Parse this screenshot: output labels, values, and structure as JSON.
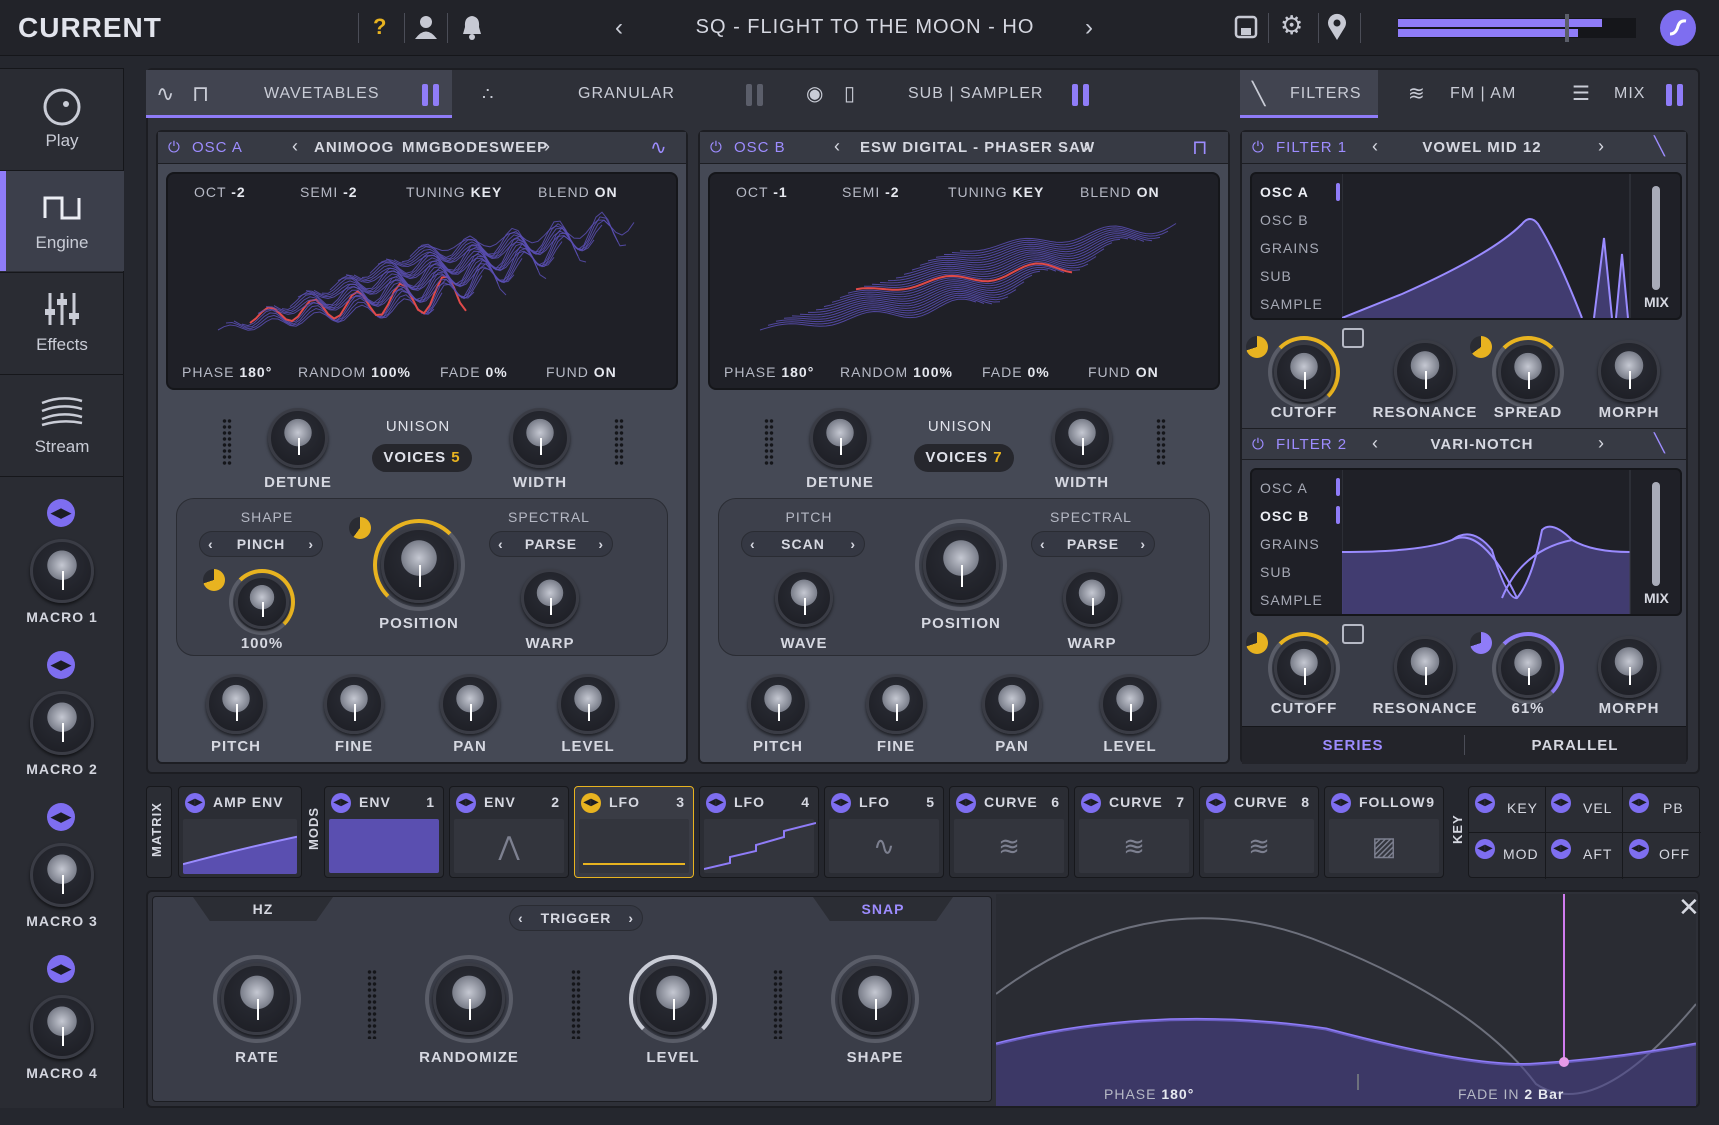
{
  "app": {
    "name": "CURRENT"
  },
  "topbar": {
    "help_icon": "question-icon",
    "preset_name": "SQ - FLIGHT TO THE MOON - HO"
  },
  "sidebar": {
    "items": [
      {
        "label": "Play",
        "icon": "play-icon"
      },
      {
        "label": "Engine",
        "icon": "wave-icon"
      },
      {
        "label": "Effects",
        "icon": "sliders-icon"
      },
      {
        "label": "Stream",
        "icon": "stream-icon"
      }
    ],
    "macros": [
      "MACRO 1",
      "MACRO 2",
      "MACRO 3",
      "MACRO 4"
    ]
  },
  "tabs": {
    "wavetables": "WAVETABLES",
    "granular": "GRANULAR",
    "sub_sampler": "SUB | SAMPLER",
    "filters": "FILTERS",
    "fm_am": "FM | AM",
    "mix": "MIX"
  },
  "osc_a": {
    "name": "OSC A",
    "wavetable_bank": "ANIMOOG",
    "wavetable": "MMGBODESWEEP",
    "oct_label": "OCT",
    "oct": "-2",
    "semi_label": "SEMI",
    "semi": "-2",
    "tuning_label": "TUNING",
    "tuning": "KEY",
    "blend_label": "BLEND",
    "blend": "ON",
    "phase_label": "PHASE",
    "phase": "180°",
    "random_label": "RANDOM",
    "random": "100%",
    "fade_label": "FADE",
    "fade": "0%",
    "fund_label": "FUND",
    "fund": "ON",
    "detune": "DETUNE",
    "unison": "UNISON",
    "voices_label": "VOICES",
    "voices": "5",
    "width": "WIDTH",
    "shape_label": "SHAPE",
    "shape": "PINCH",
    "spectral_label": "SPECTRAL",
    "spectral": "PARSE",
    "shape_amount": "100%",
    "position": "POSITION",
    "warp": "WARP",
    "pitch": "PITCH",
    "fine": "FINE",
    "pan": "PAN",
    "level": "LEVEL"
  },
  "osc_b": {
    "name": "OSC B",
    "wavetable": "ESW DIGITAL - PHASER SAW",
    "oct_label": "OCT",
    "oct": "-1",
    "semi_label": "SEMI",
    "semi": "-2",
    "tuning_label": "TUNING",
    "tuning": "KEY",
    "blend_label": "BLEND",
    "blend": "ON",
    "phase_label": "PHASE",
    "phase": "180°",
    "random_label": "RANDOM",
    "random": "100%",
    "fade_label": "FADE",
    "fade": "0%",
    "fund_label": "FUND",
    "fund": "ON",
    "detune": "DETUNE",
    "unison": "UNISON",
    "voices_label": "VOICES",
    "voices": "7",
    "width": "WIDTH",
    "pitch_label": "PITCH",
    "pitch_mode": "SCAN",
    "spectral_label": "SPECTRAL",
    "spectral": "PARSE",
    "wave": "WAVE",
    "position": "POSITION",
    "warp": "WARP",
    "pitch": "PITCH",
    "fine": "FINE",
    "pan": "PAN",
    "level": "LEVEL"
  },
  "filter1": {
    "name": "FILTER 1",
    "type": "VOWEL MID 12",
    "sources": [
      "OSC A",
      "OSC B",
      "GRAINS",
      "SUB",
      "SAMPLE"
    ],
    "mix": "MIX",
    "cutoff": "CUTOFF",
    "resonance": "RESONANCE",
    "spread": "SPREAD",
    "morph": "MORPH"
  },
  "filter2": {
    "name": "FILTER 2",
    "type": "VARI-NOTCH",
    "sources": [
      "OSC A",
      "OSC B",
      "GRAINS",
      "SUB",
      "SAMPLE"
    ],
    "mix": "MIX",
    "cutoff": "CUTOFF",
    "resonance": "RESONANCE",
    "third_value": "61%",
    "morph": "MORPH"
  },
  "routing": {
    "series": "SERIES",
    "parallel": "PARALLEL"
  },
  "mods": {
    "matrix": "MATRIX",
    "mods": "MODS",
    "key": "KEY",
    "amp_env": "AMP ENV",
    "slots": [
      {
        "label": "ENV",
        "num": "1"
      },
      {
        "label": "ENV",
        "num": "2"
      },
      {
        "label": "LFO",
        "num": "3"
      },
      {
        "label": "LFO",
        "num": "4"
      },
      {
        "label": "LFO",
        "num": "5"
      },
      {
        "label": "CURVE",
        "num": "6"
      },
      {
        "label": "CURVE",
        "num": "7"
      },
      {
        "label": "CURVE",
        "num": "8"
      },
      {
        "label": "FOLLOW",
        "num": "9"
      }
    ],
    "keys": [
      "KEY",
      "VEL",
      "PB",
      "MOD",
      "AFT",
      "OFF"
    ]
  },
  "lfo": {
    "hz": "HZ",
    "trigger": "TRIGGER",
    "snap": "SNAP",
    "rate": "RATE",
    "randomize": "RANDOMIZE",
    "level": "LEVEL",
    "shape": "SHAPE",
    "phase_label": "PHASE",
    "phase": "180°",
    "fade_label": "FADE IN",
    "fade": "2 Bar"
  },
  "colors": {
    "accent": "#8f7cf8",
    "highlight": "#e8b320",
    "background": "#25272e"
  }
}
